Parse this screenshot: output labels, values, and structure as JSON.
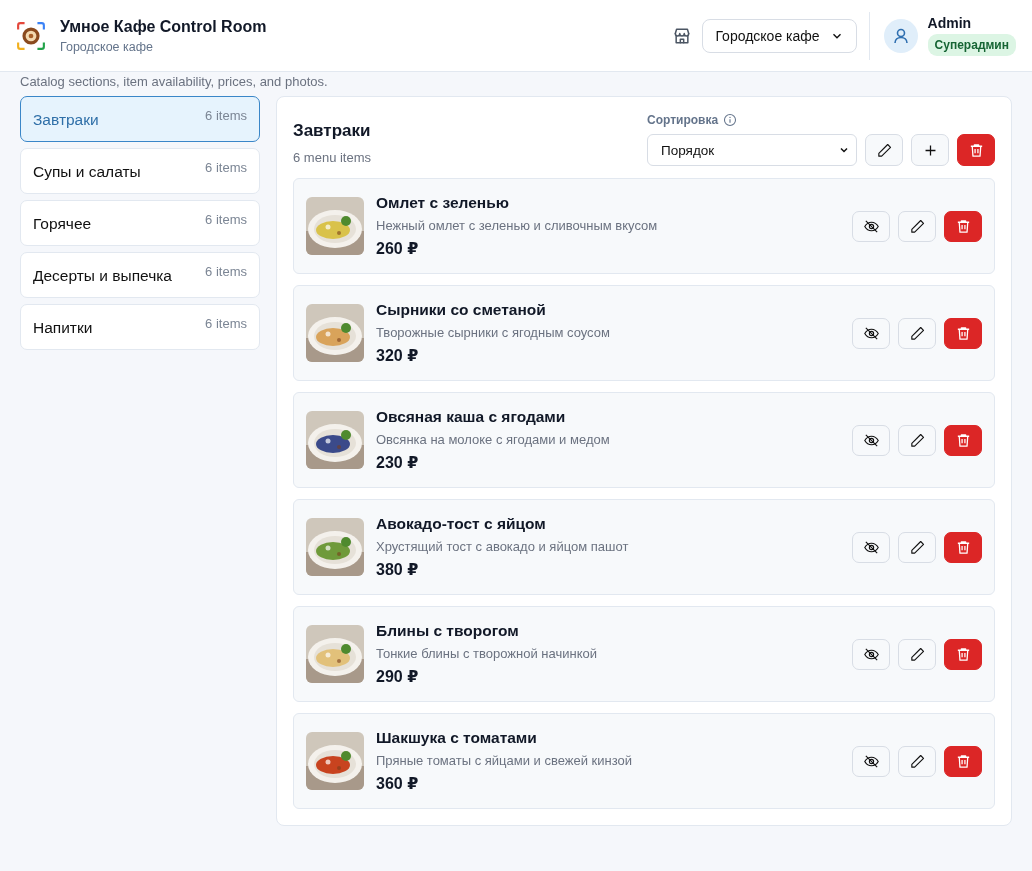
{
  "header": {
    "title": "Умное Кафе Control Room",
    "subtitle": "Городское кафе",
    "cafe_select": "Городское кафе",
    "user": {
      "name": "Admin",
      "role": "Суперадмин"
    }
  },
  "page_subtitle": "Catalog sections, item availability, prices, and photos.",
  "sections": [
    {
      "name": "Завтраки",
      "count": "6 items",
      "selected": true
    },
    {
      "name": "Супы и салаты",
      "count": "6 items",
      "selected": false
    },
    {
      "name": "Горячее",
      "count": "6 items",
      "selected": false
    },
    {
      "name": "Десерты и выпечка",
      "count": "6 items",
      "selected": false
    },
    {
      "name": "Напитки",
      "count": "6 items",
      "selected": false
    }
  ],
  "panel": {
    "title": "Завтраки",
    "count": "6 menu items",
    "sort_label": "Сортировка",
    "sort_value": "Порядок"
  },
  "items": [
    {
      "name": "Омлет с зеленью",
      "description": "Нежный омлет с зеленью и сливочным вкусом",
      "price": "260 ₽"
    },
    {
      "name": "Сырники со сметаной",
      "description": "Творожные сырники с ягодным соусом",
      "price": "320 ₽"
    },
    {
      "name": "Овсяная каша с ягодами",
      "description": "Овсянка на молоке с ягодами и медом",
      "price": "230 ₽"
    },
    {
      "name": "Авокадо-тост с яйцом",
      "description": "Хрустящий тост с авокадо и яйцом пашот",
      "price": "380 ₽"
    },
    {
      "name": "Блины с творогом",
      "description": "Тонкие блины с творожной начинкой",
      "price": "290 ₽"
    },
    {
      "name": "Шакшука с томатами",
      "description": "Пряные томаты с яйцами и свежей кинзой",
      "price": "360 ₽"
    }
  ]
}
